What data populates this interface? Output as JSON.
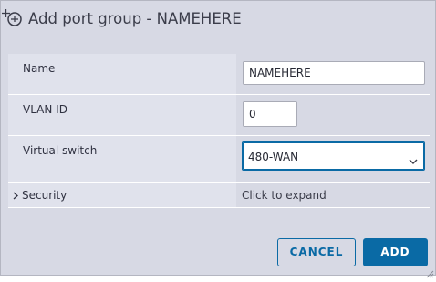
{
  "dialog": {
    "title": "Add port group - NAMEHERE",
    "title_icon": "add-network-icon"
  },
  "form": {
    "name": {
      "label": "Name",
      "value": "NAMEHERE"
    },
    "vlan": {
      "label": "VLAN ID",
      "value": "0"
    },
    "virtual_switch": {
      "label": "Virtual switch",
      "selected": "480-WAN",
      "icon": "chevron-down-icon"
    },
    "security": {
      "label": "Security",
      "value": "Click to expand",
      "icon": "chevron-right-icon"
    }
  },
  "buttons": {
    "cancel_label": "CANCEL",
    "add_label": "ADD"
  },
  "colors": {
    "accent": "#0a6aa5",
    "dialog_bg": "#d7d9e4",
    "label_cell_bg": "#e0e2ec"
  }
}
